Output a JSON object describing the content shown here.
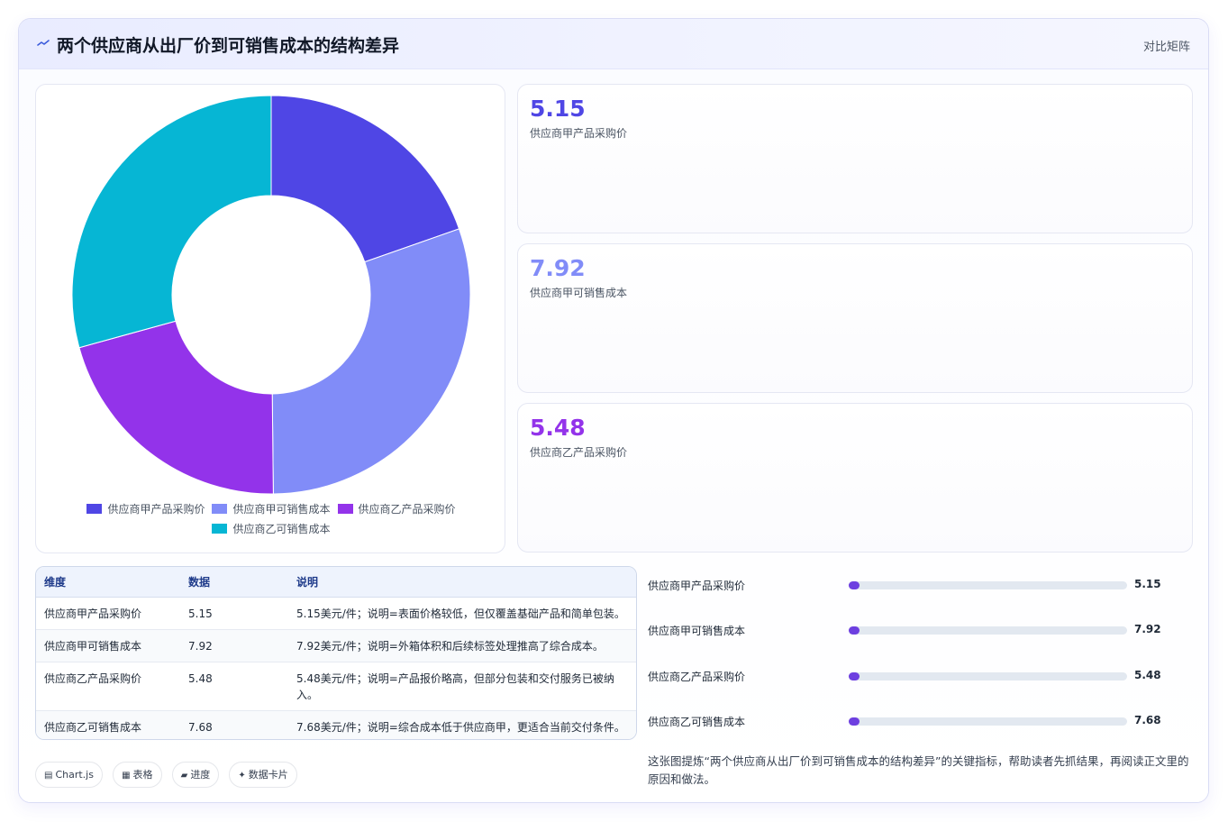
{
  "header": {
    "title": "两个供应商从出厂价到可销售成本的结构差异",
    "tag": "对比矩阵"
  },
  "colors": {
    "series_1": "#4f46e5",
    "series_2": "#818cf8",
    "series_3": "#9333ea",
    "series_4": "#06b6d4"
  },
  "chart_data": {
    "type": "pie",
    "variant": "doughnut",
    "categories": [
      "供应商甲产品采购价",
      "供应商甲可销售成本",
      "供应商乙产品采购价",
      "供应商乙可销售成本"
    ],
    "values": [
      5.15,
      7.92,
      5.48,
      7.68
    ],
    "legend_position": "bottom"
  },
  "stat_cards": [
    {
      "value": "5.15",
      "label": "供应商甲产品采购价",
      "color": "#4f46e5"
    },
    {
      "value": "7.92",
      "label": "供应商甲可销售成本",
      "color": "#818cf8"
    },
    {
      "value": "5.48",
      "label": "供应商乙产品采购价",
      "color": "#9333ea"
    }
  ],
  "table": {
    "headers": [
      "维度",
      "数据",
      "说明"
    ],
    "rows": [
      [
        "供应商甲产品采购价",
        "5.15",
        "5.15美元/件；说明=表面价格较低，但仅覆盖基础产品和简单包装。"
      ],
      [
        "供应商甲可销售成本",
        "7.92",
        "7.92美元/件；说明=外箱体积和后续标签处理推高了综合成本。"
      ],
      [
        "供应商乙产品采购价",
        "5.48",
        "5.48美元/件；说明=产品报价略高，但部分包装和交付服务已被纳入。"
      ],
      [
        "供应商乙可销售成本",
        "7.68",
        "7.68美元/件；说明=综合成本低于供应商甲，更适合当前交付条件。"
      ]
    ]
  },
  "progress": {
    "fill_fraction": 0.02,
    "items": [
      {
        "label": "供应商甲产品采购价",
        "value": "5.15"
      },
      {
        "label": "供应商甲可销售成本",
        "value": "7.92"
      },
      {
        "label": "供应商乙产品采购价",
        "value": "5.48"
      },
      {
        "label": "供应商乙可销售成本",
        "value": "7.68"
      }
    ]
  },
  "chips": [
    {
      "icon": "▤",
      "icon_name": "chart-icon",
      "label": "Chart.js"
    },
    {
      "icon": "▦",
      "icon_name": "table-icon",
      "label": "表格"
    },
    {
      "icon": "▰",
      "icon_name": "progress-icon",
      "label": "进度"
    },
    {
      "icon": "✦",
      "icon_name": "sparkle-icon",
      "label": "数据卡片"
    }
  ],
  "note": "这张图提炼“两个供应商从出厂价到可销售成本的结构差异”的关键指标，帮助读者先抓结果，再阅读正文里的原因和做法。"
}
